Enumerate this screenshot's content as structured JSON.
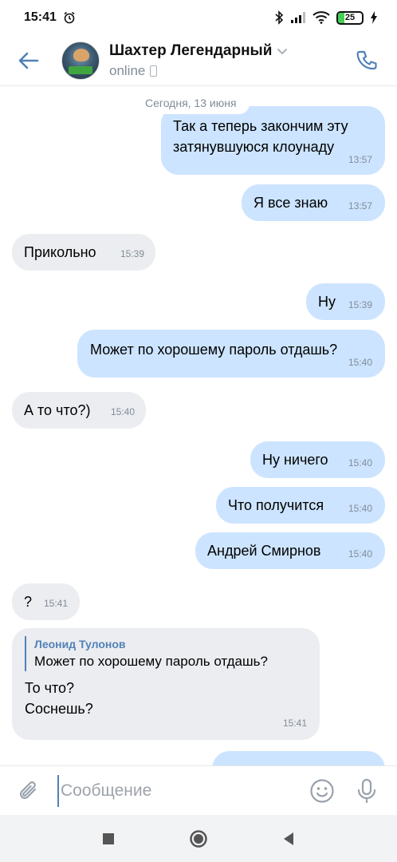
{
  "status_bar": {
    "time": "15:41",
    "battery_text": "25",
    "battery_level_percent": 25,
    "icons": [
      "alarm-icon",
      "bluetooth-icon",
      "signal-icon",
      "wifi-icon",
      "battery-icon",
      "charging-icon"
    ]
  },
  "header": {
    "contact_name": "Шахтер Легендарный",
    "status": "online",
    "icons": [
      "back-arrow-icon",
      "chevron-down-icon",
      "mobile-icon",
      "phone-icon"
    ],
    "accent_color": "#5181b8"
  },
  "conversation": {
    "date_separator": "Сегодня, 13 июня",
    "messages": [
      {
        "direction": "out",
        "text_lines": [
          "Так а теперь закончим эту",
          "затянувшуюся клоунаду"
        ],
        "time": "13:57"
      },
      {
        "direction": "out",
        "text": "Я все знаю",
        "time": "13:57"
      },
      {
        "direction": "in",
        "text": "Прикольно",
        "time": "15:39"
      },
      {
        "direction": "out",
        "text": "Ну",
        "time": "15:39"
      },
      {
        "direction": "out",
        "text": "Может по хорошему пароль отдашь?",
        "time": "15:40"
      },
      {
        "direction": "in",
        "text": "А то что?)",
        "time": "15:40"
      },
      {
        "direction": "out",
        "text": "Ну ничего",
        "time": "15:40"
      },
      {
        "direction": "out",
        "text": "Что получится",
        "time": "15:40"
      },
      {
        "direction": "out",
        "text": "Андрей Смирнов",
        "time": "15:40"
      },
      {
        "direction": "in",
        "text": "?",
        "time": "15:41"
      },
      {
        "direction": "in",
        "reply": {
          "name": "Леонид Тулонов",
          "text": "Может по хорошему пароль отдашь?"
        },
        "text_lines": [
          "То что?",
          "Соснешь?"
        ],
        "time": "15:41"
      }
    ],
    "colors": {
      "outgoing": "#cce4ff",
      "incoming": "#ebedf0",
      "time": "#818c99"
    }
  },
  "composer": {
    "placeholder": "Сообщение",
    "icons": [
      "paperclip-icon",
      "emoji-icon",
      "microphone-icon"
    ]
  },
  "nav_bar": {
    "icons": [
      "recent-apps-icon",
      "home-icon",
      "back-icon"
    ]
  }
}
